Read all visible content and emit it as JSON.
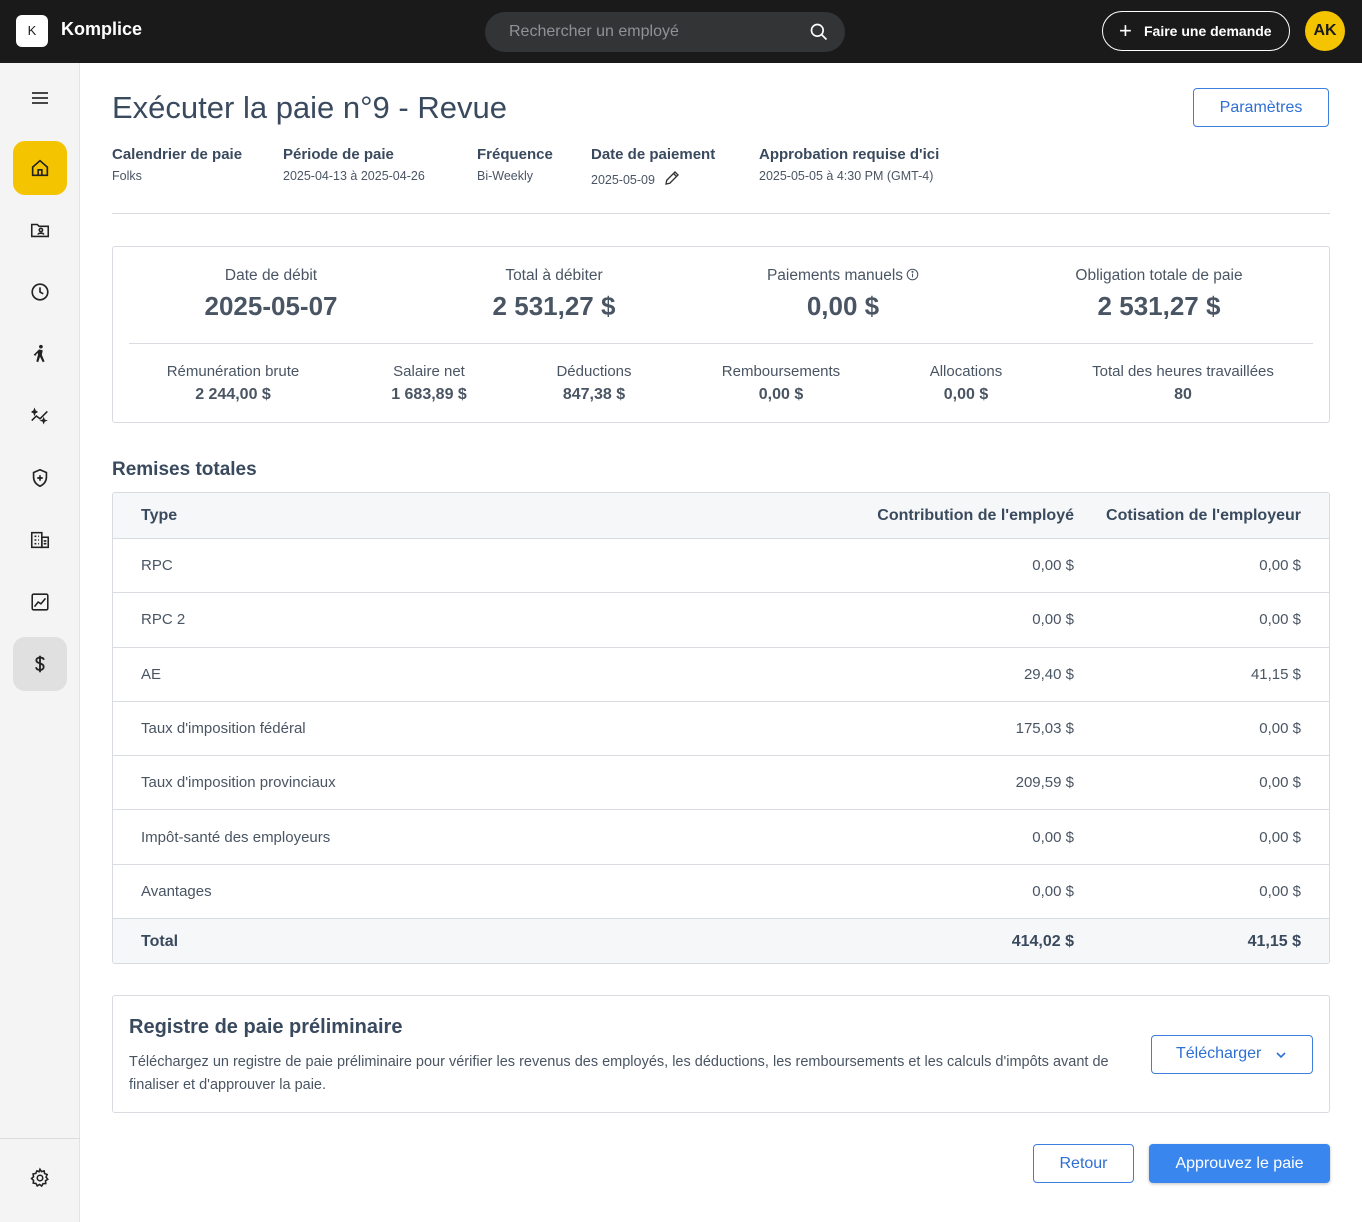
{
  "header": {
    "logo_letter": "K",
    "app_name": "Komplice",
    "search_placeholder": "Rechercher un employé",
    "request_button": "Faire une demande",
    "avatar_initials": "AK"
  },
  "sidebar": {
    "items": [
      {
        "name": "home",
        "icon": "home-icon",
        "state": "active"
      },
      {
        "name": "documents",
        "icon": "folder-user-icon"
      },
      {
        "name": "time",
        "icon": "clock-icon"
      },
      {
        "name": "people",
        "icon": "person-walking-icon"
      },
      {
        "name": "performance",
        "icon": "sparkle-chart-icon"
      },
      {
        "name": "benefits",
        "icon": "shield-plus-icon"
      },
      {
        "name": "company",
        "icon": "building-icon"
      },
      {
        "name": "reports",
        "icon": "chart-icon"
      },
      {
        "name": "payroll",
        "icon": "dollar-icon",
        "state": "selected"
      }
    ],
    "settings_icon": "gear-icon"
  },
  "page": {
    "title": "Exécuter la paie n°9 - Revue",
    "settings_button": "Paramètres",
    "meta": [
      {
        "label": "Calendrier de paie",
        "value": "Folks"
      },
      {
        "label": "Période de paie",
        "value": "2025-04-13 à 2025-04-26"
      },
      {
        "label": "Fréquence",
        "value": "Bi-Weekly"
      },
      {
        "label": "Date de paiement",
        "value": "2025-05-09"
      },
      {
        "label": "Approbation requise d'ici",
        "value": "2025-05-05 à 4:30 PM (GMT-4)"
      }
    ]
  },
  "summary": {
    "top": [
      {
        "label": "Date de débit",
        "value": "2025-05-07"
      },
      {
        "label": "Total à débiter",
        "value": "2 531,27 $"
      },
      {
        "label": "Paiements manuels",
        "value": "0,00 $"
      },
      {
        "label": "Obligation totale de paie",
        "value": "2 531,27 $"
      }
    ],
    "bottom": [
      {
        "label": "Rémunération brute",
        "value": "2 244,00 $"
      },
      {
        "label": "Salaire net",
        "value": "1 683,89 $"
      },
      {
        "label": "Déductions",
        "value": "847,38 $"
      },
      {
        "label": "Remboursements",
        "value": "0,00 $"
      },
      {
        "label": "Allocations",
        "value": "0,00 $"
      },
      {
        "label": "Total des heures travaillées",
        "value": "80"
      }
    ]
  },
  "remittances": {
    "title": "Remises totales",
    "columns": [
      "Type",
      "Contribution de l'employé",
      "Cotisation de l'employeur"
    ],
    "rows": [
      [
        "RPC",
        "0,00 $",
        "0,00 $"
      ],
      [
        "RPC 2",
        "0,00 $",
        "0,00 $"
      ],
      [
        "AE",
        "29,40 $",
        "41,15 $"
      ],
      [
        "Taux d'imposition fédéral",
        "175,03 $",
        "0,00 $"
      ],
      [
        "Taux d'imposition provinciaux",
        "209,59 $",
        "0,00 $"
      ],
      [
        "Impôt-santé des employeurs",
        "0,00 $",
        "0,00 $"
      ],
      [
        "Avantages",
        "0,00 $",
        "0,00 $"
      ]
    ],
    "total": [
      "Total",
      "414,02 $",
      "41,15 $"
    ]
  },
  "register": {
    "title": "Registre de paie préliminaire",
    "description": "Téléchargez un registre de paie préliminaire pour vérifier les revenus des employés, les déductions, les remboursements et les calculs d'impôts avant de finaliser et d'approuver la paie.",
    "download_button": "Télécharger"
  },
  "footer": {
    "back_button": "Retour",
    "approve_button": "Approuvez le paie"
  },
  "colors": {
    "topbar": "#1a1a1a",
    "accent_yellow": "#f5c400",
    "primary_blue": "#3a86ef"
  }
}
